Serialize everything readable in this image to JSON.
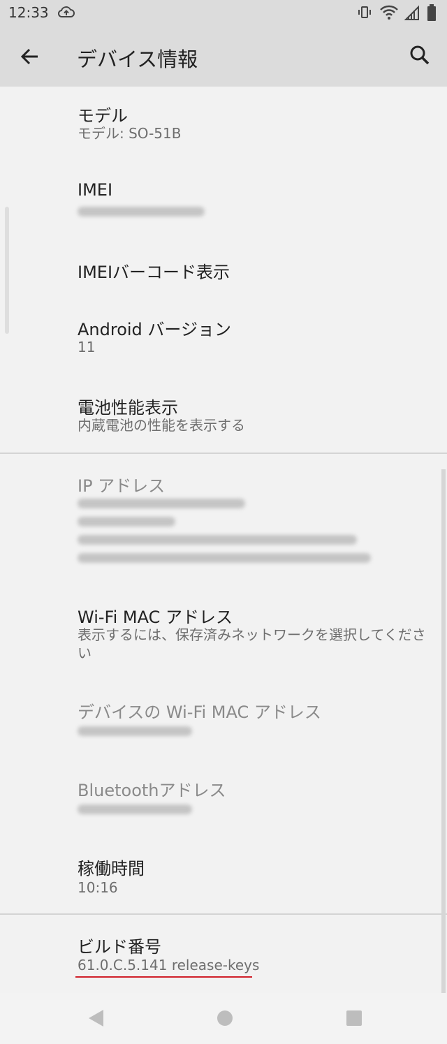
{
  "status_bar": {
    "time": "12:33"
  },
  "app_bar": {
    "title": "デバイス情報"
  },
  "items": {
    "model": {
      "title": "モデル",
      "subtitle": "モデル: SO-51B"
    },
    "imei": {
      "title": "IMEI"
    },
    "imei_barcode": {
      "title": "IMEIバーコード表示"
    },
    "android_version": {
      "title": "Android バージョン",
      "subtitle": "11"
    },
    "battery": {
      "title": "電池性能表示",
      "subtitle": "内蔵電池の性能を表示する"
    },
    "ip_address": {
      "title": "IP アドレス"
    },
    "wifi_mac": {
      "title": "Wi-Fi MAC アドレス",
      "subtitle": "表示するには、保存済みネットワークを選択してください"
    },
    "device_wifi_mac": {
      "title": "デバイスの Wi-Fi MAC アドレス"
    },
    "bluetooth": {
      "title": "Bluetoothアドレス"
    },
    "uptime": {
      "title": "稼働時間",
      "subtitle": "10:16"
    },
    "build_number": {
      "title": "ビルド番号",
      "subtitle": "61.0.C.5.141 release-keys"
    }
  },
  "icons": {
    "back": "arrow-back-icon",
    "search": "search-icon",
    "nav_back": "triangle-back-icon",
    "nav_home": "circle-home-icon",
    "nav_recents": "square-recents-icon"
  },
  "colors": {
    "accent_underline": "#d0202a",
    "app_bar_bg": "#dcdcdc",
    "page_bg": "#f2f2f2"
  }
}
